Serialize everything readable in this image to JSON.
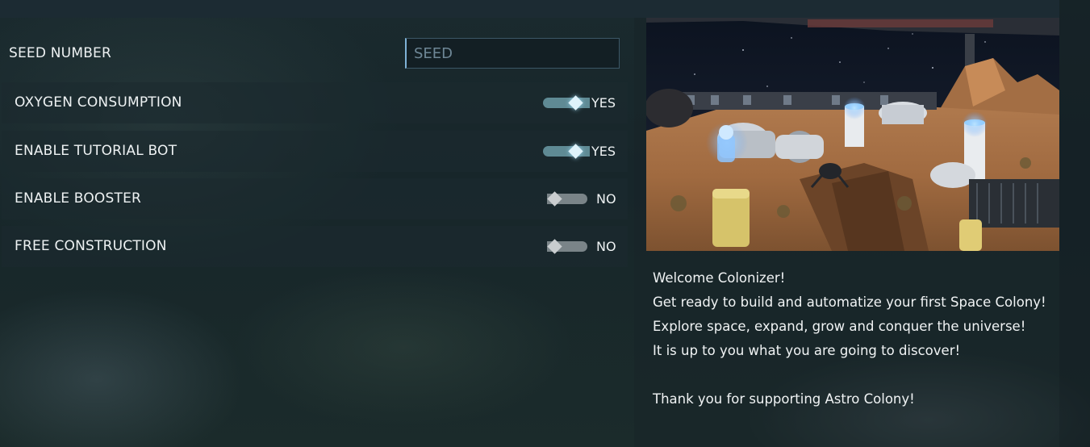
{
  "settings": {
    "seed": {
      "label": "SEED NUMBER",
      "placeholder": "SEED",
      "value": ""
    },
    "options": [
      {
        "label": "OXYGEN CONSUMPTION",
        "state": "YES",
        "enabled": true
      },
      {
        "label": "ENABLE TUTORIAL BOT",
        "state": "YES",
        "enabled": true
      },
      {
        "label": "ENABLE BOOSTER",
        "state": "NO",
        "enabled": false
      },
      {
        "label": "FREE CONSTRUCTION",
        "state": "NO",
        "enabled": false
      }
    ]
  },
  "welcome": {
    "lines": [
      "Welcome Colonizer!",
      "Get ready to build and automatize your first Space Colony!",
      "Explore space, expand, grow and conquer the universe!",
      "It is up to you what you are going to discover!"
    ],
    "thanks": "Thank you for supporting Astro Colony!"
  },
  "colors": {
    "toggle_on_track": "#5f8a94",
    "toggle_on_knob": "#dff3fb",
    "toggle_off_track": "#7a8488",
    "input_focus_border": "#7fb2d6"
  }
}
